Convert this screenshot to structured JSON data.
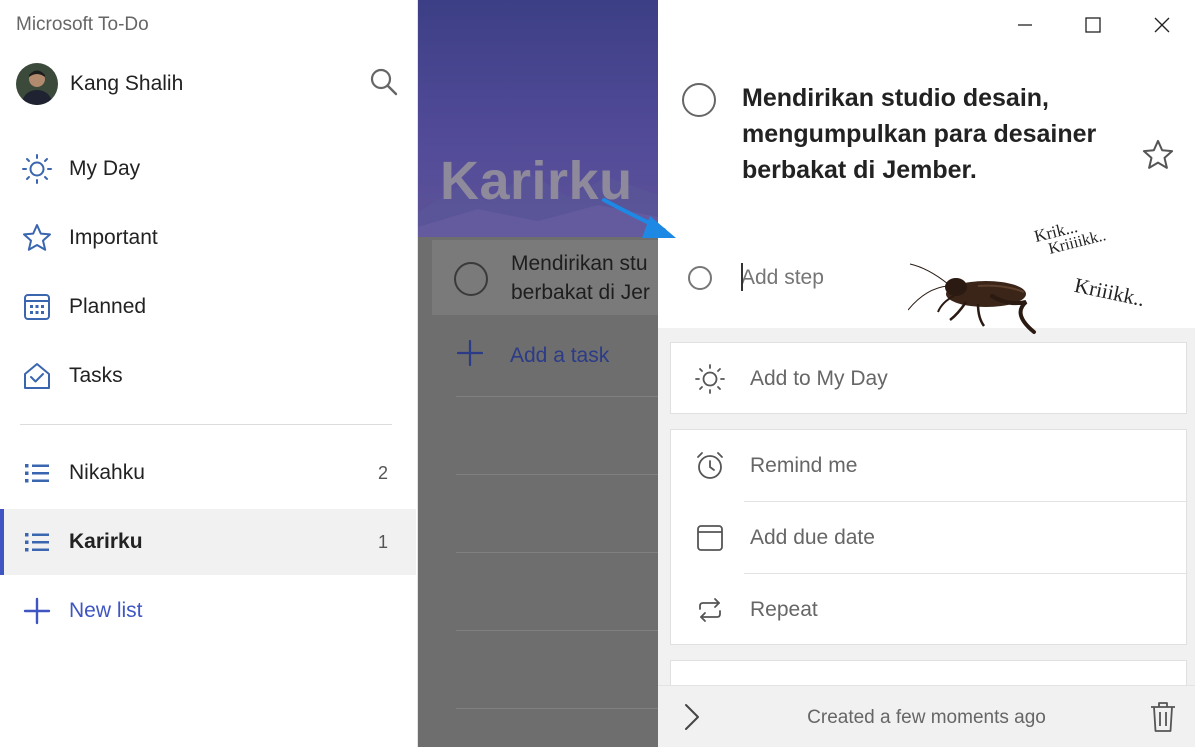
{
  "app": {
    "title": "Microsoft To-Do"
  },
  "user": {
    "name": "Kang Shalih"
  },
  "sidebar": {
    "items": [
      {
        "label": "My Day",
        "icon": "sun-icon"
      },
      {
        "label": "Important",
        "icon": "star-icon"
      },
      {
        "label": "Planned",
        "icon": "calendar-icon"
      },
      {
        "label": "Tasks",
        "icon": "home-check-icon"
      }
    ],
    "lists": [
      {
        "label": "Nikahku",
        "count": "2",
        "icon": "list-icon"
      },
      {
        "label": "Karirku",
        "count": "1",
        "icon": "list-icon",
        "active": true
      }
    ],
    "new_list_label": "New list"
  },
  "middle": {
    "list_title": "Karirku",
    "task_text_line1": "Mendirikan stu",
    "task_text_line2": "berbakat di Jer",
    "add_task_label": "Add a task"
  },
  "detail": {
    "task_title": "Mendirikan studio desain, mengumpulkan para desainer berbakat di Jember.",
    "add_step_placeholder": "Add step",
    "add_to_my_day": "Add to My Day",
    "remind_me": "Remind me",
    "add_due_date": "Add due date",
    "repeat": "Repeat",
    "created_text": "Created a few moments ago"
  },
  "annotation": {
    "sound1": "Krik...",
    "sound2": "Kriiiikk..",
    "sound3": "Kriiikk.."
  },
  "colors": {
    "accent": "#3f56c2",
    "arrow": "#1e88e5"
  }
}
